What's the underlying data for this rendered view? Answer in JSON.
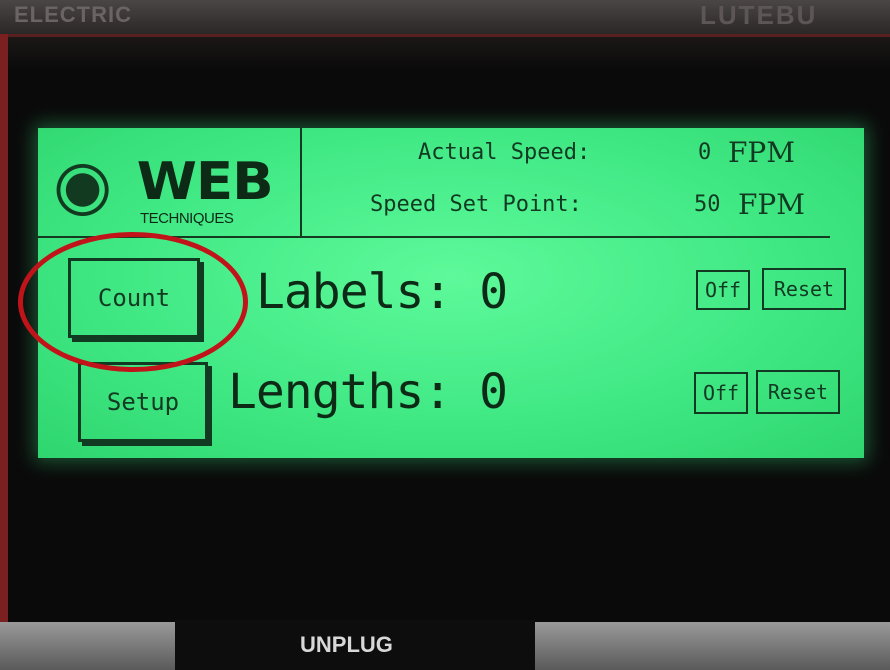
{
  "device": {
    "brand_left": "ELECTRIC",
    "brand_right": "LUTEBU",
    "unplug_label": "UNPLUG"
  },
  "header": {
    "logo_web": "WEB",
    "logo_tech": "TECHNIQUES",
    "actual_speed_label": "Actual Speed:",
    "actual_speed_value": "0",
    "actual_speed_unit": "FPM",
    "set_point_label": "Speed Set Point:",
    "set_point_value": "50",
    "set_point_unit": "FPM"
  },
  "buttons": {
    "count": "Count",
    "setup": "Setup"
  },
  "counters": {
    "labels_text": "Labels: 0",
    "lengths_text": "Lengths: 0",
    "labels_off": "Off",
    "labels_reset": "Reset",
    "lengths_off": "Off",
    "lengths_reset": "Reset"
  },
  "colors": {
    "lcd_green": "#41e985",
    "lcd_text": "#0d2a17",
    "annotation_red": "#c0141a"
  }
}
